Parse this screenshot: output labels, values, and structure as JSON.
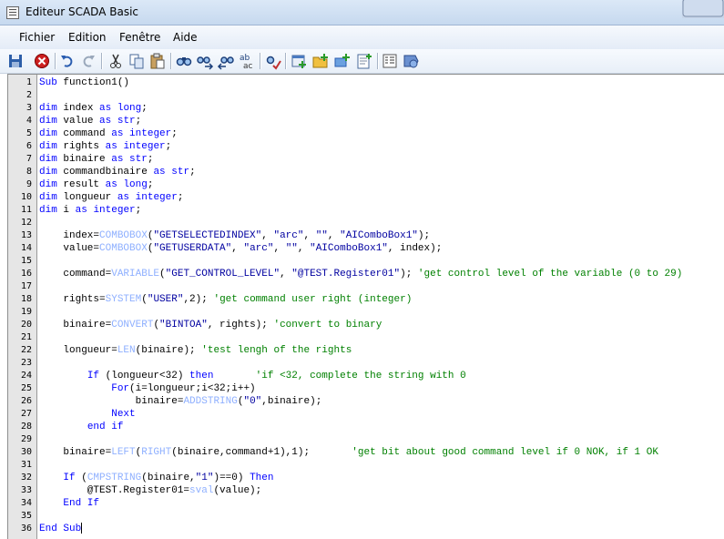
{
  "window": {
    "title": "Editeur SCADA Basic"
  },
  "menu": [
    "Fichier",
    "Edition",
    "Fenêtre",
    "Aide"
  ],
  "toolbar": [
    "save",
    "close",
    "undo",
    "redo",
    "cut",
    "copy",
    "paste",
    "find",
    "find-next",
    "find-previous",
    "replace",
    "spell-check",
    "add-dialog",
    "add-folder",
    "add-variable",
    "add-page",
    "properties",
    "help"
  ],
  "colors": {
    "keyword": "#0000ff",
    "function": "#8fb0ff",
    "string": "#0000a0",
    "comment": "#008000",
    "gutter": "#e6e6e6"
  },
  "lines": [
    [
      [
        "kw",
        "Sub"
      ],
      [
        "t",
        " function1()"
      ]
    ],
    [],
    [
      [
        "kw",
        "dim"
      ],
      [
        "t",
        " index "
      ],
      [
        "kw",
        "as"
      ],
      [
        "t",
        " "
      ],
      [
        "kw",
        "long"
      ],
      [
        "t",
        ";"
      ]
    ],
    [
      [
        "kw",
        "dim"
      ],
      [
        "t",
        " value "
      ],
      [
        "kw",
        "as"
      ],
      [
        "t",
        " "
      ],
      [
        "kw",
        "str"
      ],
      [
        "t",
        ";"
      ]
    ],
    [
      [
        "kw",
        "dim"
      ],
      [
        "t",
        " command "
      ],
      [
        "kw",
        "as"
      ],
      [
        "t",
        " "
      ],
      [
        "kw",
        "integer"
      ],
      [
        "t",
        ";"
      ]
    ],
    [
      [
        "kw",
        "dim"
      ],
      [
        "t",
        " rights "
      ],
      [
        "kw",
        "as"
      ],
      [
        "t",
        " "
      ],
      [
        "kw",
        "integer"
      ],
      [
        "t",
        ";"
      ]
    ],
    [
      [
        "kw",
        "dim"
      ],
      [
        "t",
        " binaire "
      ],
      [
        "kw",
        "as"
      ],
      [
        "t",
        " "
      ],
      [
        "kw",
        "str"
      ],
      [
        "t",
        ";"
      ]
    ],
    [
      [
        "kw",
        "dim"
      ],
      [
        "t",
        " commandbinaire "
      ],
      [
        "kw",
        "as"
      ],
      [
        "t",
        " "
      ],
      [
        "kw",
        "str"
      ],
      [
        "t",
        ";"
      ]
    ],
    [
      [
        "kw",
        "dim"
      ],
      [
        "t",
        " result "
      ],
      [
        "kw",
        "as"
      ],
      [
        "t",
        " "
      ],
      [
        "kw",
        "long"
      ],
      [
        "t",
        ";"
      ]
    ],
    [
      [
        "kw",
        "dim"
      ],
      [
        "t",
        " longueur "
      ],
      [
        "kw",
        "as"
      ],
      [
        "t",
        " "
      ],
      [
        "kw",
        "integer"
      ],
      [
        "t",
        ";"
      ]
    ],
    [
      [
        "kw",
        "dim"
      ],
      [
        "t",
        " i "
      ],
      [
        "kw",
        "as"
      ],
      [
        "t",
        " "
      ],
      [
        "kw",
        "integer"
      ],
      [
        "t",
        ";"
      ]
    ],
    [],
    [
      [
        "t",
        "    index="
      ],
      [
        "fn",
        "COMBOBOX"
      ],
      [
        "t",
        "("
      ],
      [
        "str",
        "\"GETSELECTEDINDEX\""
      ],
      [
        "t",
        ", "
      ],
      [
        "str",
        "\"arc\""
      ],
      [
        "t",
        ", "
      ],
      [
        "str",
        "\"\""
      ],
      [
        "t",
        ", "
      ],
      [
        "str",
        "\"AIComboBox1\""
      ],
      [
        "t",
        ");"
      ]
    ],
    [
      [
        "t",
        "    value="
      ],
      [
        "fn",
        "COMBOBOX"
      ],
      [
        "t",
        "("
      ],
      [
        "str",
        "\"GETUSERDATA\""
      ],
      [
        "t",
        ", "
      ],
      [
        "str",
        "\"arc\""
      ],
      [
        "t",
        ", "
      ],
      [
        "str",
        "\"\""
      ],
      [
        "t",
        ", "
      ],
      [
        "str",
        "\"AIComboBox1\""
      ],
      [
        "t",
        ", index);"
      ]
    ],
    [],
    [
      [
        "t",
        "    command="
      ],
      [
        "fn",
        "VARIABLE"
      ],
      [
        "t",
        "("
      ],
      [
        "str",
        "\"GET_CONTROL_LEVEL\""
      ],
      [
        "t",
        ", "
      ],
      [
        "str",
        "\"@TEST.Register01\""
      ],
      [
        "t",
        "); "
      ],
      [
        "cmt",
        "'get control level of the variable (0 to 29)"
      ]
    ],
    [],
    [
      [
        "t",
        "    rights="
      ],
      [
        "fn",
        "SYSTEM"
      ],
      [
        "t",
        "("
      ],
      [
        "str",
        "\"USER\""
      ],
      [
        "t",
        ",2); "
      ],
      [
        "cmt",
        "'get command user right (integer)"
      ]
    ],
    [],
    [
      [
        "t",
        "    binaire="
      ],
      [
        "fn",
        "CONVERT"
      ],
      [
        "t",
        "("
      ],
      [
        "str",
        "\"BINTOA\""
      ],
      [
        "t",
        ", rights); "
      ],
      [
        "cmt",
        "'convert to binary"
      ]
    ],
    [],
    [
      [
        "t",
        "    longueur="
      ],
      [
        "fn",
        "LEN"
      ],
      [
        "t",
        "(binaire); "
      ],
      [
        "cmt",
        "'test lengh of the rights"
      ]
    ],
    [],
    [
      [
        "t",
        "        "
      ],
      [
        "kw",
        "If"
      ],
      [
        "t",
        " (longueur<32) "
      ],
      [
        "kw",
        "then"
      ],
      [
        "t",
        "       "
      ],
      [
        "cmt",
        "'if <32, complete the string with 0"
      ]
    ],
    [
      [
        "t",
        "            "
      ],
      [
        "kw",
        "For"
      ],
      [
        "t",
        "(i=longueur;i<32;i++)"
      ]
    ],
    [
      [
        "t",
        "                binaire="
      ],
      [
        "fn",
        "ADDSTRING"
      ],
      [
        "t",
        "("
      ],
      [
        "str",
        "\"0\""
      ],
      [
        "t",
        ",binaire);"
      ]
    ],
    [
      [
        "t",
        "            "
      ],
      [
        "kw",
        "Next"
      ]
    ],
    [
      [
        "t",
        "        "
      ],
      [
        "kw",
        "end if"
      ]
    ],
    [],
    [
      [
        "t",
        "    binaire="
      ],
      [
        "fn",
        "LEFT"
      ],
      [
        "t",
        "("
      ],
      [
        "fn",
        "RIGHT"
      ],
      [
        "t",
        "(binaire,command+1),1);       "
      ],
      [
        "cmt",
        "'get bit about good command level if 0 NOK, if 1 OK"
      ]
    ],
    [],
    [
      [
        "t",
        "    "
      ],
      [
        "kw",
        "If"
      ],
      [
        "t",
        " ("
      ],
      [
        "fn",
        "CMPSTRING"
      ],
      [
        "t",
        "(binaire,"
      ],
      [
        "str",
        "\"1\""
      ],
      [
        "t",
        ")==0) "
      ],
      [
        "kw",
        "Then"
      ]
    ],
    [
      [
        "t",
        "        @TEST.Register01="
      ],
      [
        "fn",
        "sval"
      ],
      [
        "t",
        "(value);"
      ]
    ],
    [
      [
        "t",
        "    "
      ],
      [
        "kw",
        "End If"
      ]
    ],
    [],
    [
      [
        "kw",
        "End Sub"
      ]
    ]
  ]
}
